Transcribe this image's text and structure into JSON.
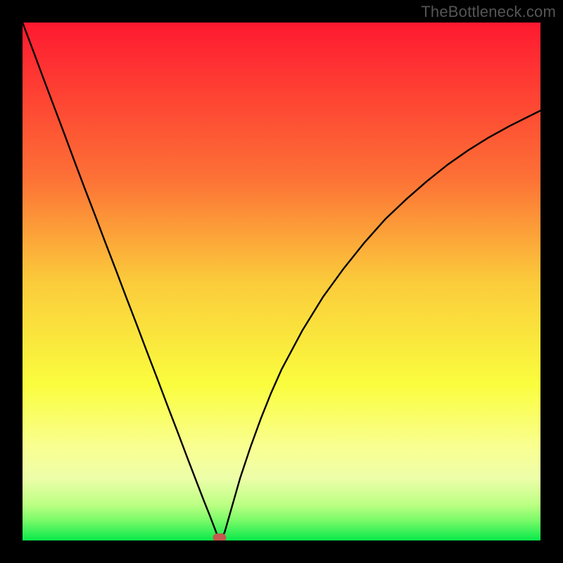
{
  "watermark": {
    "text": "TheBottleneck.com"
  },
  "chart_data": {
    "type": "line",
    "title": "",
    "xlabel": "",
    "ylabel": "",
    "xlim": [
      0,
      100
    ],
    "ylim": [
      0,
      100
    ],
    "grid": false,
    "series": [
      {
        "name": "bottleneck-curve",
        "x": [
          0,
          2,
          4,
          6,
          8,
          10,
          12,
          14,
          16,
          18,
          20,
          22,
          24,
          26,
          28,
          30,
          32,
          34,
          35,
          36,
          37,
          37.5,
          38,
          38.5,
          39,
          40,
          42,
          44,
          46,
          48,
          50,
          54,
          58,
          62,
          66,
          70,
          74,
          78,
          82,
          86,
          90,
          94,
          98,
          100
        ],
        "y": [
          100,
          94.7,
          89.3,
          84,
          78.7,
          73.3,
          68,
          62.8,
          57.5,
          52.3,
          47.0,
          41.8,
          36.5,
          31.3,
          26.0,
          20.8,
          15.5,
          10.3,
          7.7,
          5.2,
          2.6,
          1.3,
          0.6,
          0.8,
          1.5,
          5.0,
          12.0,
          18.0,
          23.5,
          28.5,
          33.0,
          40.5,
          47.0,
          52.5,
          57.5,
          62.0,
          65.8,
          69.3,
          72.5,
          75.3,
          77.8,
          80.0,
          82.0,
          83.0
        ]
      }
    ],
    "marker": {
      "name": "optimum-point",
      "x": 38,
      "y": 0.6,
      "color": "#c35a4f"
    },
    "gradient_stops": [
      {
        "offset": 0,
        "color": "#fe1930"
      },
      {
        "offset": 30,
        "color": "#fd7136"
      },
      {
        "offset": 50,
        "color": "#fbcb3b"
      },
      {
        "offset": 70,
        "color": "#fafd3e"
      },
      {
        "offset": 82,
        "color": "#f9ff91"
      },
      {
        "offset": 88,
        "color": "#edfea9"
      },
      {
        "offset": 93,
        "color": "#bdff84"
      },
      {
        "offset": 96,
        "color": "#7dfb69"
      },
      {
        "offset": 100,
        "color": "#09e94b"
      }
    ]
  }
}
